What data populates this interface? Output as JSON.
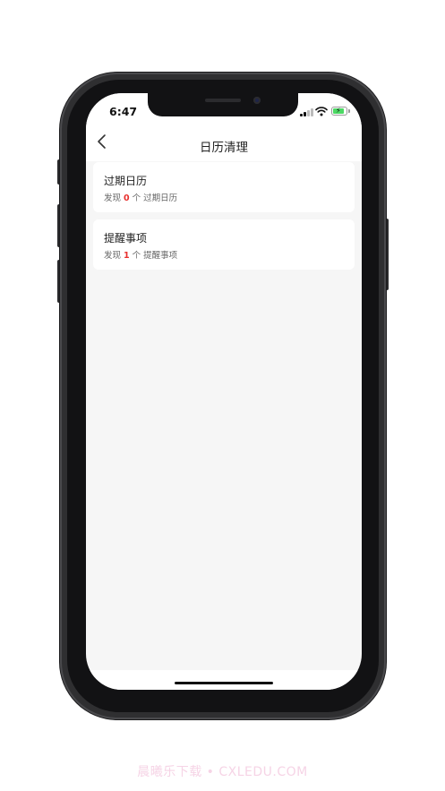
{
  "status_bar": {
    "time": "6:47"
  },
  "nav": {
    "title": "日历清理"
  },
  "cards": [
    {
      "title": "过期日历",
      "desc_prefix": "发现",
      "count": "0",
      "desc_suffix": "个 过期日历"
    },
    {
      "title": "提醒事项",
      "desc_prefix": "发现",
      "count": "1",
      "desc_suffix": "个 提醒事项"
    }
  ],
  "watermark": "晨曦乐下载 • CXLEDU.COM",
  "colors": {
    "accent_count": "#e8302e",
    "screen_bg": "#f6f6f6",
    "card_bg": "#ffffff",
    "battery": "#4cd964"
  },
  "icons": {
    "back": "chevron-left-icon",
    "signal": "cellular-signal-icon",
    "wifi": "wifi-icon",
    "battery": "battery-charging-icon"
  }
}
